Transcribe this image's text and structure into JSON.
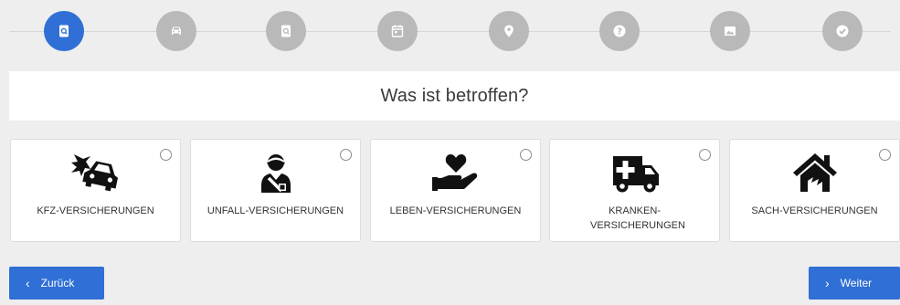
{
  "question": "Was ist betroffen?",
  "steps": [
    {
      "icon": "search-doc-icon",
      "active": true
    },
    {
      "icon": "car-icon",
      "active": false
    },
    {
      "icon": "search-doc-icon",
      "active": false
    },
    {
      "icon": "calendar-icon",
      "active": false
    },
    {
      "icon": "location-pin-icon",
      "active": false
    },
    {
      "icon": "question-icon",
      "active": false
    },
    {
      "icon": "image-icon",
      "active": false
    },
    {
      "icon": "check-icon",
      "active": false
    }
  ],
  "options": [
    {
      "label": "KFZ-VERSICHERUNGEN",
      "icon": "car-crash-icon"
    },
    {
      "label": "UNFALL-VERSICHERUNGEN",
      "icon": "injured-person-icon"
    },
    {
      "label": "LEBEN-VERSICHERUNGEN",
      "icon": "hand-heart-icon"
    },
    {
      "label": "KRANKEN-VERSICHERUNGEN",
      "icon": "ambulance-icon"
    },
    {
      "label": "SACH-VERSICHERUNGEN",
      "icon": "house-icon"
    }
  ],
  "buttons": {
    "back": "Zurück",
    "next": "Weiter"
  },
  "colors": {
    "accent": "#2f6fd6",
    "inactive_step": "#b9b9b9",
    "background": "#eeeeee"
  }
}
